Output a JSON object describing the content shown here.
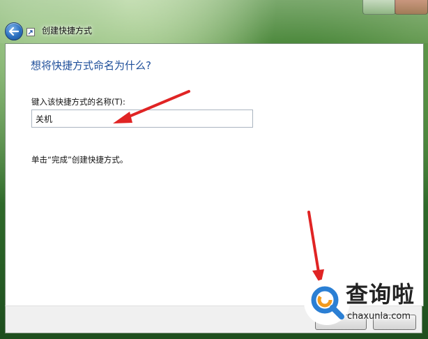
{
  "window": {
    "title": "创建快捷方式"
  },
  "page": {
    "heading": "想将快捷方式命名为什么?",
    "field_label": "键入该快捷方式的名称(T):",
    "name_value": "关机",
    "hint": "单击“完成”创建快捷方式。"
  },
  "colors": {
    "heading": "#1f4f9a",
    "annotation_arrow": "#e02424",
    "watermark_accent": "#2b7fd4"
  },
  "icons": {
    "back": "back-arrow-icon",
    "shortcut": "shortcut-icon",
    "watermark": "magnifier-logo-icon"
  },
  "watermark": {
    "brand": "查询啦",
    "url": "chaxunla.com"
  }
}
